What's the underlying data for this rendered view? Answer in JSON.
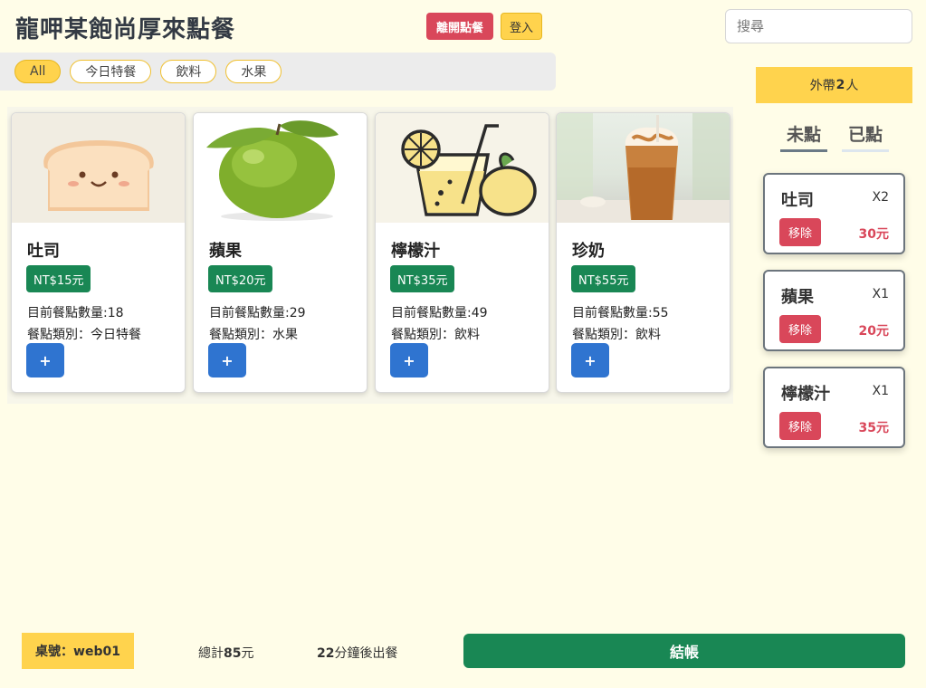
{
  "header": {
    "title": "龍呷某飽尚厚來點餐",
    "leave_label": "離開點餐",
    "login_label": "登入",
    "search_placeholder": "搜尋"
  },
  "filters": [
    {
      "label": "All",
      "active": true
    },
    {
      "label": "今日特餐",
      "active": false
    },
    {
      "label": "飲料",
      "active": false
    },
    {
      "label": "水果",
      "active": false
    }
  ],
  "menu": [
    {
      "name": "吐司",
      "price": "NT$15元",
      "count": "目前餐點數量:18",
      "category": "餐點類別：今日特餐",
      "add_label": "+",
      "image": "toast-illustration"
    },
    {
      "name": "蘋果",
      "price": "NT$20元",
      "count": "目前餐點數量:29",
      "category": "餐點類別：水果",
      "add_label": "+",
      "image": "green-apple-photo"
    },
    {
      "name": "檸檬汁",
      "price": "NT$35元",
      "count": "目前餐點數量:49",
      "category": "餐點類別：飲料",
      "add_label": "+",
      "image": "lemonade-illustration"
    },
    {
      "name": "珍奶",
      "price": "NT$55元",
      "count": "目前餐點數量:55",
      "category": "餐點類別：飲料",
      "add_label": "+",
      "image": "milk-tea-photo"
    }
  ],
  "sidebar": {
    "takeout_prefix": "外帶",
    "takeout_count": "2",
    "takeout_suffix": "人",
    "tabs": [
      {
        "label": "未點",
        "active": true
      },
      {
        "label": "已點",
        "active": false
      }
    ],
    "orders": [
      {
        "name": "吐司",
        "qty": "X2",
        "remove_label": "移除",
        "price": "30元"
      },
      {
        "name": "蘋果",
        "qty": "X1",
        "remove_label": "移除",
        "price": "20元"
      },
      {
        "name": "檸檬汁",
        "qty": "X1",
        "remove_label": "移除",
        "price": "35元"
      }
    ]
  },
  "footer": {
    "table_label": "桌號：web01",
    "total_prefix": "總計",
    "total_value": "85",
    "total_suffix": "元",
    "eta_value": "22",
    "eta_suffix": "分鐘後出餐",
    "checkout_label": "結帳"
  },
  "colors": {
    "background": "#fffde8",
    "accent_yellow": "#ffd34d",
    "danger": "#d9475a",
    "success": "#198754",
    "primary": "#2f74d0"
  }
}
